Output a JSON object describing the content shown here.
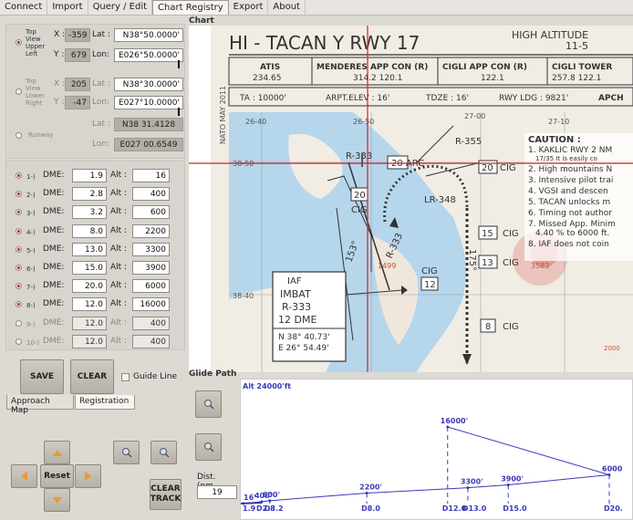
{
  "menu": [
    "Connect",
    "Import",
    "Query / Edit",
    "Chart Registry",
    "Export",
    "About"
  ],
  "active_menu": "Chart Registry",
  "reference_points": {
    "top_left": {
      "label": [
        "Top",
        "View",
        "Upper",
        "Left"
      ],
      "x": "-359",
      "y": "679",
      "lat": "N38°50.0000'",
      "lon": "E026°50.0000'"
    },
    "bottom_right": {
      "label": [
        "Top",
        "View",
        "Lower",
        "Right"
      ],
      "x": "205",
      "y": "-47",
      "lat": "N38°30.0000'",
      "lon": "E027°10.0000'"
    },
    "runway": {
      "label": "Runway",
      "lat": "N38 31.4128",
      "lon": "E027 00.6549"
    }
  },
  "axis_labels": {
    "x": "X :",
    "y": "Y :",
    "lat": "Lat :",
    "lon": "Lon:"
  },
  "dme_label": "DME:",
  "alt_label": "Alt :",
  "dme_rows": [
    {
      "idx": "1-)",
      "dme": "1.9",
      "alt": "16",
      "on": true
    },
    {
      "idx": "2-)",
      "dme": "2.8",
      "alt": "400",
      "on": true
    },
    {
      "idx": "3-)",
      "dme": "3.2",
      "alt": "600",
      "on": true
    },
    {
      "idx": "4-)",
      "dme": "8.0",
      "alt": "2200",
      "on": true
    },
    {
      "idx": "5-)",
      "dme": "13.0",
      "alt": "3300",
      "on": true
    },
    {
      "idx": "6-)",
      "dme": "15.0",
      "alt": "3900",
      "on": true
    },
    {
      "idx": "7-)",
      "dme": "20.0",
      "alt": "6000",
      "on": true
    },
    {
      "idx": "8-)",
      "dme": "12.0",
      "alt": "16000",
      "on": true
    },
    {
      "idx": "9-)",
      "dme": "12.0",
      "alt": "400",
      "on": false
    },
    {
      "idx": "10-)",
      "dme": "12.0",
      "alt": "400",
      "on": false
    }
  ],
  "buttons": {
    "save": "SAVE",
    "clear": "CLEAR",
    "guide_line": "Guide Line",
    "reset": "Reset",
    "clear_track": [
      "CLEAR",
      "TRACK"
    ]
  },
  "panel_tabs": [
    "Approach Map",
    "Registration"
  ],
  "active_panel_tab": "Registration",
  "dist": {
    "label": "Dist. (nm",
    "value": "19"
  },
  "chart": {
    "section_title": "Chart",
    "header": "HI - TACAN Y RWY 17",
    "high_altitude": "HIGH ALTITUDE",
    "page_ref": "11-5",
    "side_note": "NATO MAY 2011",
    "atis": {
      "name": "ATIS",
      "freq": "234.65"
    },
    "menderes": {
      "name": "MENDERES APP CON (R)",
      "freq": "314.2  120.1"
    },
    "cigli_app": {
      "name": "CIGLI APP CON (R)",
      "freq": "122.1"
    },
    "cigli_tower": {
      "name": "CIGLI TOWER",
      "freq": "257.8  122.1"
    },
    "ta": "TA : 10000'",
    "arpt_elev": "ARPT.ELEV : 16'",
    "tdze": "TDZE : 16'",
    "rwy_ldg": "RWY LDG : 9821'",
    "apch": "APCH",
    "caution_title": "CAUTION :",
    "caution_lines": [
      "1. KAKLIC RWY 2 NM",
      "17/35 It is easily co",
      "2. High mountains N",
      "3. Intensive pilot trai",
      "4. VGSI and descen",
      "5. TACAN unlocks m",
      "6. Timing not author",
      "7. Missed App. Minim",
      "4.40 % to 6000 ft.",
      "8. IAF does not coin"
    ],
    "grid_labels": [
      "26-40",
      "26-50",
      "27-00",
      "27-10",
      "38-50",
      "38-40"
    ],
    "radials": [
      "R-333",
      "R-355",
      "LR-348",
      "R-333",
      "153°",
      "175°"
    ],
    "fixes": [
      "20 ARC",
      "20",
      "CIG",
      "20",
      "CIG",
      "15",
      "CIG",
      "13",
      "CIG",
      "8",
      "CIG",
      "CIG",
      "12"
    ],
    "elevations": [
      "1499",
      "3583",
      "2000"
    ],
    "iaf": {
      "title": "IAF",
      "name": "IMBAT",
      "radial": "R-333",
      "dme": "12 DME",
      "lat": "N 38° 40.73'",
      "lon": "E 26° 54.49'"
    }
  },
  "glide": {
    "section_title": "Glide Path",
    "alt_label": "Alt 24000'ft",
    "points": [
      {
        "dme": 1.9,
        "alt": 16,
        "x_label": "1.9",
        "alt_label": "16'"
      },
      {
        "dme": 2.8,
        "alt": 400,
        "x_label": "D2.8",
        "alt_label": "400'"
      },
      {
        "dme": 3.2,
        "alt": 600,
        "x_label": "D3.2",
        "alt_label": "600'"
      },
      {
        "dme": 8.0,
        "alt": 2200,
        "x_label": "D8.0",
        "alt_label": "2200'"
      },
      {
        "dme": 13.0,
        "alt": 3300,
        "x_label": "D13.0",
        "alt_label": "3300'"
      },
      {
        "dme": 15.0,
        "alt": 3900,
        "x_label": "D15.0",
        "alt_label": "3900'"
      },
      {
        "dme": 20.0,
        "alt": 6000,
        "x_label": "D20.",
        "alt_label": "6000"
      },
      {
        "dme": 12.0,
        "alt": 16000,
        "x_label": "D12.0",
        "alt_label": "16000'"
      }
    ]
  },
  "colors": {
    "map_water": "#b6d6ec",
    "map_land": "#f1ede4",
    "crosshair": "#d42020",
    "glide_line": "#3a3ab8",
    "accent_orange": "#e89a2c"
  }
}
